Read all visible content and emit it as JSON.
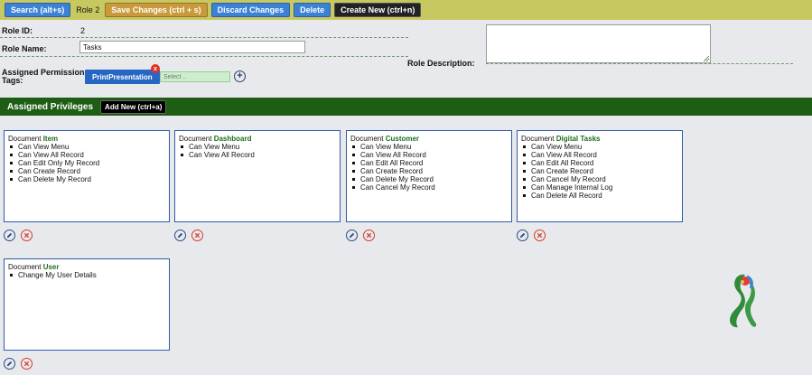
{
  "toolbar": {
    "search_label": "Search (alt+s)",
    "role_label": "Role 2",
    "save_label": "Save Changes (ctrl + s)",
    "discard_label": "Discard Changes",
    "delete_label": "Delete",
    "create_label": "Create New (ctrl+n)"
  },
  "form": {
    "role_id_label": "Role ID:",
    "role_id_value": "2",
    "role_name_label": "Role Name:",
    "role_name_value": "Tasks",
    "role_description_label": "Role Description:",
    "role_description_value": "",
    "assigned_tags_label_line1": "Assigned Permission",
    "assigned_tags_label_line2": "Tags:",
    "tag": "PrintPresentation",
    "tag_remove": "x",
    "select_placeholder": "Select ..",
    "add_symbol": "+"
  },
  "privileges": {
    "title": "Assigned Privileges",
    "add_new_label": "Add New (ctrl+a)",
    "doc_prefix": "Document",
    "cards": [
      {
        "document": "Item",
        "items": [
          "Can View Menu",
          "Can View All Record",
          "Can Edit Only My Record",
          "Can Create Record",
          "Can Delete My Record"
        ]
      },
      {
        "document": "Dashboard",
        "items": [
          "Can View Menu",
          "Can View All Record"
        ]
      },
      {
        "document": "Customer",
        "items": [
          "Can View Menu",
          "Can View All Record",
          "Can Edit All Record",
          "Can Create Record",
          "Can Delete My Record",
          "Can Cancel My Record"
        ]
      },
      {
        "document": "Digital Tasks",
        "items": [
          "Can View Menu",
          "Can View All Record",
          "Can Edit All Record",
          "Can Create Record",
          "Can Cancel My Record",
          "Can Manage Internal Log",
          "Can Delete All Record"
        ]
      },
      {
        "document": "User",
        "items": [
          "Change My User Details"
        ]
      }
    ]
  },
  "icons": {
    "edit": "pencil-icon",
    "delete": "close-circle-icon",
    "logo": "brand-logo-icon"
  },
  "colors": {
    "toolbar_bg": "#c8c860",
    "primary_button": "#3b82d6",
    "save_button": "#c99a3c",
    "privileges_bar": "#1e5e14",
    "document_name": "#1d6e1d",
    "delete_icon": "#d23a2a"
  }
}
